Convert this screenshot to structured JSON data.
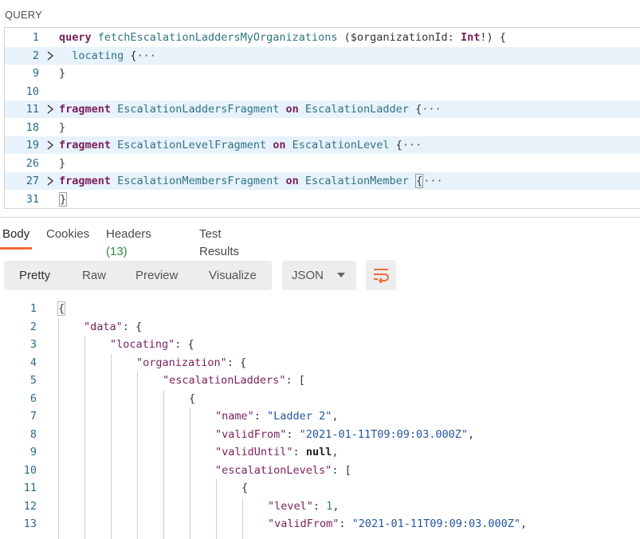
{
  "query_section": {
    "label": "QUERY",
    "lines": [
      {
        "n": "1",
        "fold": false,
        "hl": false,
        "tokens": [
          {
            "t": "query",
            "c": "kw"
          },
          {
            "t": " ",
            "c": "plain"
          },
          {
            "t": "fetchEscalationLaddersMyOrganizations",
            "c": "fn"
          },
          {
            "t": " ($organizationId: ",
            "c": "var"
          },
          {
            "t": "Int",
            "c": "kw"
          },
          {
            "t": "!) {",
            "c": "plain"
          }
        ]
      },
      {
        "n": "2",
        "fold": true,
        "hl": true,
        "tokens": [
          {
            "t": "  locating ",
            "c": "tp"
          },
          {
            "t": "{",
            "c": "plain"
          },
          {
            "t": "···",
            "c": "ell"
          }
        ]
      },
      {
        "n": "9",
        "fold": false,
        "hl": false,
        "tokens": [
          {
            "t": "}",
            "c": "plain"
          }
        ]
      },
      {
        "n": "10",
        "fold": false,
        "hl": false,
        "tokens": []
      },
      {
        "n": "11",
        "fold": true,
        "hl": true,
        "tokens": [
          {
            "t": "fragment",
            "c": "kw"
          },
          {
            "t": " EscalationLaddersFragment ",
            "c": "tp"
          },
          {
            "t": "on",
            "c": "kw"
          },
          {
            "t": " EscalationLadder ",
            "c": "tp"
          },
          {
            "t": "{",
            "c": "plain"
          },
          {
            "t": "···",
            "c": "ell"
          }
        ]
      },
      {
        "n": "18",
        "fold": false,
        "hl": false,
        "tokens": [
          {
            "t": "}",
            "c": "plain"
          }
        ]
      },
      {
        "n": "19",
        "fold": true,
        "hl": true,
        "tokens": [
          {
            "t": "fragment",
            "c": "kw"
          },
          {
            "t": " EscalationLevelFragment ",
            "c": "tp"
          },
          {
            "t": "on",
            "c": "kw"
          },
          {
            "t": " EscalationLevel ",
            "c": "tp"
          },
          {
            "t": "{",
            "c": "plain"
          },
          {
            "t": "···",
            "c": "ell"
          }
        ]
      },
      {
        "n": "26",
        "fold": false,
        "hl": false,
        "tokens": [
          {
            "t": "}",
            "c": "plain"
          }
        ]
      },
      {
        "n": "27",
        "fold": true,
        "hl": true,
        "tokens": [
          {
            "t": "fragment",
            "c": "kw"
          },
          {
            "t": " EscalationMembersFragment ",
            "c": "tp"
          },
          {
            "t": "on",
            "c": "kw"
          },
          {
            "t": " EscalationMember ",
            "c": "tp"
          },
          {
            "t": "{",
            "c": "cursor"
          },
          {
            "t": "···",
            "c": "ell"
          }
        ]
      },
      {
        "n": "31",
        "fold": false,
        "hl": false,
        "tokens": [
          {
            "t": "}",
            "c": "cursor"
          }
        ]
      }
    ]
  },
  "response_tabs": [
    {
      "label": "Body",
      "badge": "",
      "active": true
    },
    {
      "label": "Cookies",
      "badge": "",
      "active": false
    },
    {
      "label": "Headers",
      "badge": "(13)",
      "active": false
    },
    {
      "label": "Test Results",
      "badge": "",
      "active": false
    }
  ],
  "view_modes": [
    "Pretty",
    "Raw",
    "Preview",
    "Visualize"
  ],
  "format_select": {
    "value": "JSON"
  },
  "icons": {
    "fold": "chevron-right-icon",
    "wrap": "wrap-lines-icon",
    "select": "chevron-down-icon"
  },
  "colors": {
    "accent": "#f26b3a",
    "keyword": "#7a1f5c",
    "type": "#2e7582",
    "string": "#2455a0",
    "number": "#2e8a4d"
  },
  "response_body": {
    "lines": [
      {
        "n": "1",
        "indent": 0,
        "tokens": [
          {
            "t": "{",
            "c": "bracehl"
          }
        ]
      },
      {
        "n": "2",
        "indent": 1,
        "tokens": [
          {
            "t": "\"data\"",
            "c": "key"
          },
          {
            "t": ": {",
            "c": "punc"
          }
        ]
      },
      {
        "n": "3",
        "indent": 2,
        "tokens": [
          {
            "t": "\"locating\"",
            "c": "key"
          },
          {
            "t": ": {",
            "c": "punc"
          }
        ]
      },
      {
        "n": "4",
        "indent": 3,
        "tokens": [
          {
            "t": "\"organization\"",
            "c": "key"
          },
          {
            "t": ": {",
            "c": "punc"
          }
        ]
      },
      {
        "n": "5",
        "indent": 4,
        "tokens": [
          {
            "t": "\"escalationLadders\"",
            "c": "key"
          },
          {
            "t": ": [",
            "c": "punc"
          }
        ]
      },
      {
        "n": "6",
        "indent": 5,
        "tokens": [
          {
            "t": "{",
            "c": "punc"
          }
        ]
      },
      {
        "n": "7",
        "indent": 6,
        "tokens": [
          {
            "t": "\"name\"",
            "c": "key"
          },
          {
            "t": ": ",
            "c": "punc"
          },
          {
            "t": "\"Ladder 2\"",
            "c": "str"
          },
          {
            "t": ",",
            "c": "punc"
          }
        ]
      },
      {
        "n": "8",
        "indent": 6,
        "tokens": [
          {
            "t": "\"validFrom\"",
            "c": "key"
          },
          {
            "t": ": ",
            "c": "punc"
          },
          {
            "t": "\"2021-01-11T09:09:03.000Z\"",
            "c": "str"
          },
          {
            "t": ",",
            "c": "punc"
          }
        ]
      },
      {
        "n": "9",
        "indent": 6,
        "tokens": [
          {
            "t": "\"validUntil\"",
            "c": "key"
          },
          {
            "t": ": ",
            "c": "punc"
          },
          {
            "t": "null",
            "c": "nul"
          },
          {
            "t": ",",
            "c": "punc"
          }
        ]
      },
      {
        "n": "10",
        "indent": 6,
        "tokens": [
          {
            "t": "\"escalationLevels\"",
            "c": "key"
          },
          {
            "t": ": [",
            "c": "punc"
          }
        ]
      },
      {
        "n": "11",
        "indent": 7,
        "tokens": [
          {
            "t": "{",
            "c": "punc"
          }
        ]
      },
      {
        "n": "12",
        "indent": 8,
        "tokens": [
          {
            "t": "\"level\"",
            "c": "key"
          },
          {
            "t": ": ",
            "c": "punc"
          },
          {
            "t": "1",
            "c": "num"
          },
          {
            "t": ",",
            "c": "punc"
          }
        ]
      },
      {
        "n": "13",
        "indent": 8,
        "tokens": [
          {
            "t": "\"validFrom\"",
            "c": "key"
          },
          {
            "t": ": ",
            "c": "punc"
          },
          {
            "t": "\"2021-01-11T09:09:03.000Z\"",
            "c": "str"
          },
          {
            "t": ",",
            "c": "punc"
          }
        ]
      }
    ]
  }
}
